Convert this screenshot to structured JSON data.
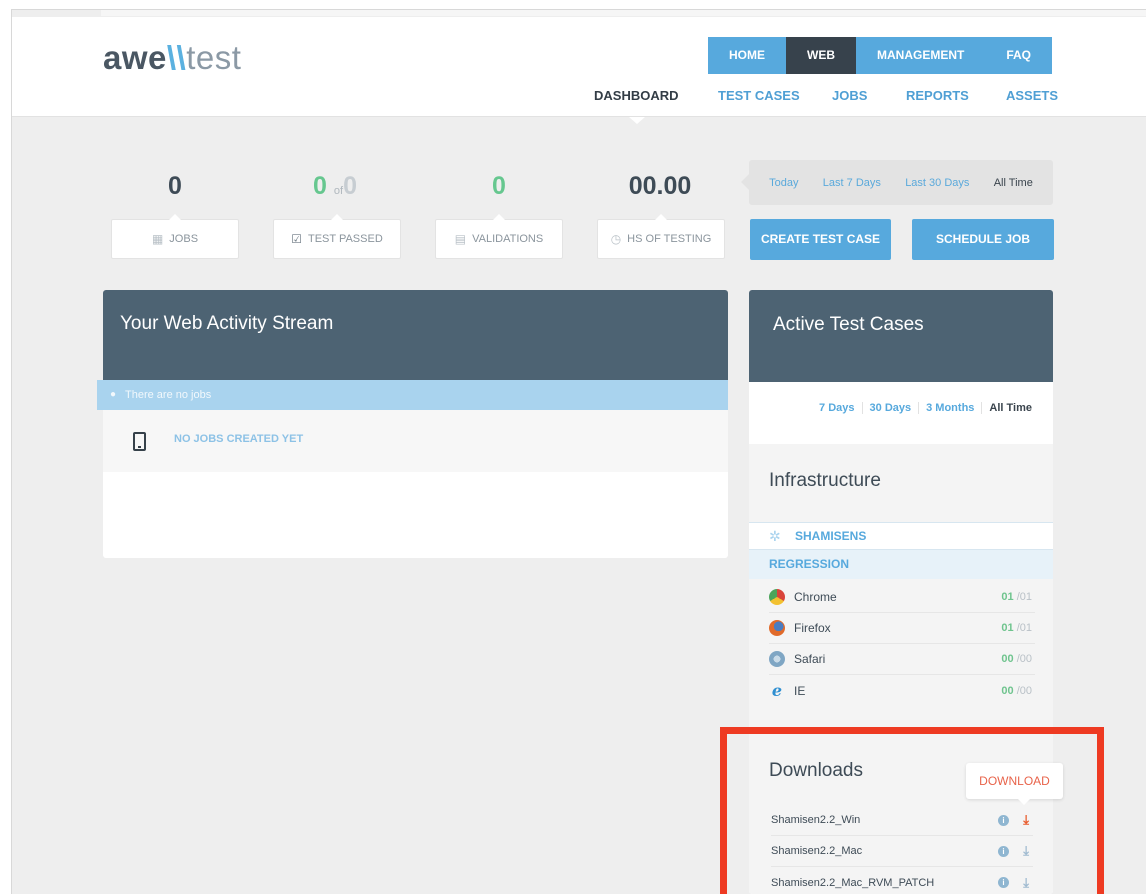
{
  "logo": {
    "part1": "awe",
    "part2": "\\\\",
    "part3": "test"
  },
  "main_nav": [
    {
      "label": "HOME",
      "active": false
    },
    {
      "label": "WEB",
      "active": true
    },
    {
      "label": "MANAGEMENT",
      "active": false
    },
    {
      "label": "FAQ",
      "active": false
    }
  ],
  "sub_nav": [
    {
      "label": "DASHBOARD",
      "active": true
    },
    {
      "label": "TEST CASES",
      "active": false
    },
    {
      "label": "JOBS",
      "active": false
    },
    {
      "label": "REPORTS",
      "active": false
    },
    {
      "label": "ASSETS",
      "active": false
    }
  ],
  "stats": {
    "jobs": {
      "value": "0",
      "label": "JOBS",
      "icon": "briefcase-icon"
    },
    "passed": {
      "value": "0",
      "of": "of",
      "total": "0",
      "label": "TEST PASSED",
      "icon": "checkbox-icon"
    },
    "validations": {
      "value": "0",
      "label": "VALIDATIONS",
      "icon": "calendar-icon"
    },
    "hours": {
      "value": "00.00",
      "label": "HS OF TESTING",
      "icon": "clock-icon"
    }
  },
  "time_filter": [
    {
      "label": "Today",
      "active": false
    },
    {
      "label": "Last 7 Days",
      "active": false
    },
    {
      "label": "Last 30 Days",
      "active": false
    },
    {
      "label": "All Time",
      "active": true
    }
  ],
  "buttons": {
    "create": "CREATE TEST CASE",
    "schedule": "SCHEDULE JOB"
  },
  "activity": {
    "title": "Your Web Activity Stream",
    "notice": "There are no jobs",
    "empty_message": "NO JOBS CREATED YET"
  },
  "active_tests": {
    "title": "Active Test Cases",
    "ranges": [
      "7 Days",
      "30 Days",
      "3 Months",
      "All Time"
    ]
  },
  "infrastructure": {
    "title": "Infrastructure",
    "node": "SHAMISENS",
    "group": "REGRESSION",
    "browsers": [
      {
        "name": "Chrome",
        "passed": "01",
        "total": "/01",
        "color": "#e2a93b"
      },
      {
        "name": "Firefox",
        "passed": "01",
        "total": "/01",
        "color": "#e06a2a"
      },
      {
        "name": "Safari",
        "passed": "00",
        "total": "/00",
        "color": "#7fa6c4"
      },
      {
        "name": "IE",
        "passed": "00",
        "total": "/00",
        "color": "#2f8fd1",
        "glyph": "e"
      }
    ]
  },
  "downloads": {
    "title": "Downloads",
    "tooltip": "DOWNLOAD",
    "info_glyph": "i",
    "download_glyph": "⤓",
    "items": [
      "Shamisen2.2_Win",
      "Shamisen2.2_Mac",
      "Shamisen2.2_Mac_RVM_PATCH"
    ]
  },
  "colors": {
    "accent": "#57a9dd",
    "panel_header": "#4d6373",
    "green": "#66c78f",
    "highlight": "#ee3a22",
    "download_active": "#e85a2b"
  }
}
